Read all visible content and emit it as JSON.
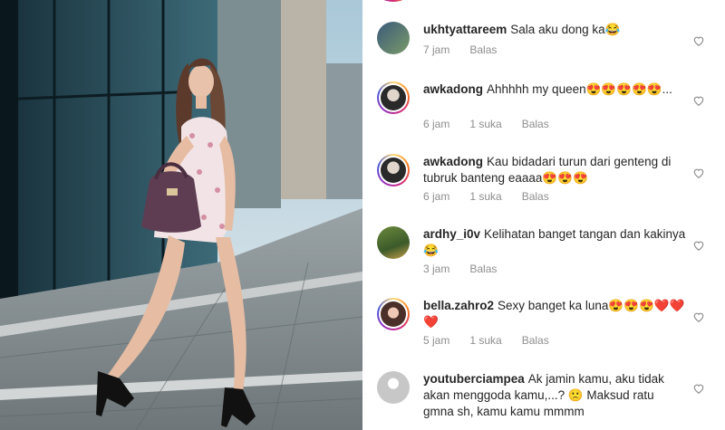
{
  "comments": [
    {
      "username": "ukhtyattareem",
      "text": "Sala aku dong ka😂",
      "time": "7 jam",
      "likes": "",
      "reply": "Balas"
    },
    {
      "username": "awkadong",
      "text": "Ahhhhh my queen😍😍😍😍😍...",
      "time": "6 jam",
      "likes": "1 suka",
      "reply": "Balas"
    },
    {
      "username": "awkadong",
      "text": "Kau bidadari turun dari genteng di tubruk banteng eaaaa😍😍😍",
      "time": "6 jam",
      "likes": "1 suka",
      "reply": "Balas"
    },
    {
      "username": "ardhy_i0v",
      "text": "Kelihatan banget tangan dan kakinya😂",
      "time": "3 jam",
      "likes": "",
      "reply": "Balas"
    },
    {
      "username": "bella.zahro2",
      "text": "Sexy banget ka luna😍😍😍❤️❤️❤️",
      "time": "5 jam",
      "likes": "1 suka",
      "reply": "Balas"
    },
    {
      "username": "youtuberciampea",
      "text": "Ak jamin kamu, aku tidak akan menggoda kamu,...? 🙁 Maksud ratu gmna sh, kamu kamu mmmm",
      "time": "",
      "likes": "",
      "reply": ""
    }
  ],
  "colors": {
    "text": "#262626",
    "meta": "#8e8e8e",
    "heart": "#8e8e8e"
  }
}
